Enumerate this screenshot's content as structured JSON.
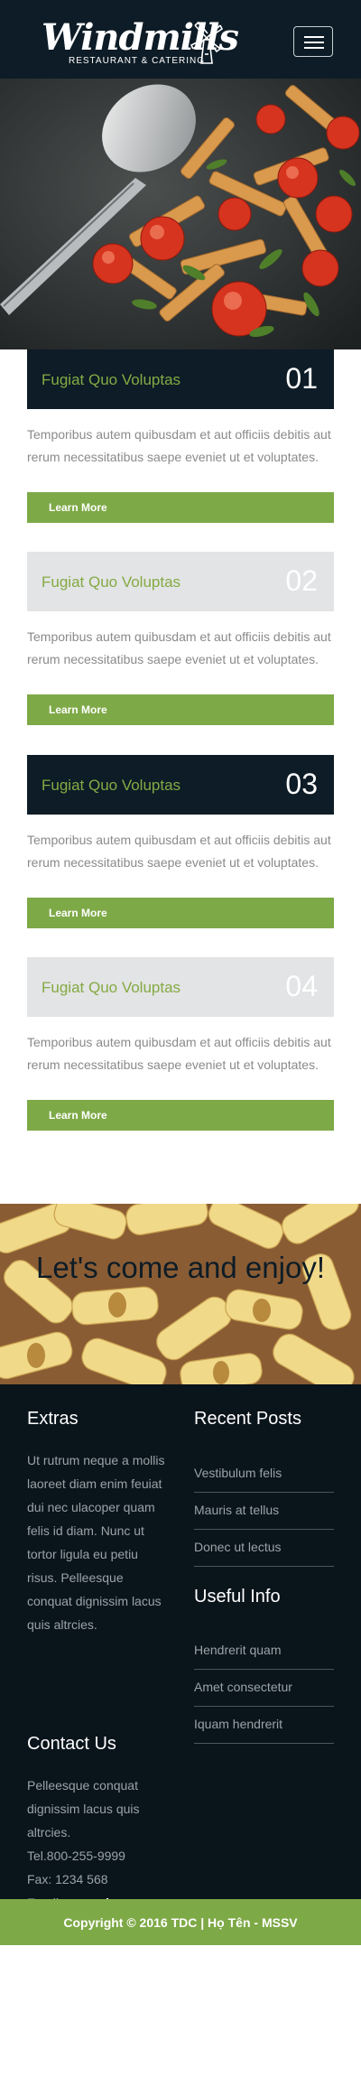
{
  "brand": {
    "name": "Windmills",
    "tagline": "RESTAURANT & CATERING"
  },
  "header": {
    "menu_icon": "hamburger-icon"
  },
  "features": [
    {
      "title": "Fugiat Quo Voluptas",
      "number": "01",
      "text": "Temporibus autem quibusdam et aut officiis debitis aut rerum necessitatibus saepe eveniet ut et voluptates.",
      "button": "Learn More"
    },
    {
      "title": "Fugiat Quo Voluptas",
      "number": "02",
      "text": "Temporibus autem quibusdam et aut officiis debitis aut rerum necessitatibus saepe eveniet ut et voluptates.",
      "button": "Learn More"
    },
    {
      "title": "Fugiat Quo Voluptas",
      "number": "03",
      "text": "Temporibus autem quibusdam et aut officiis debitis aut rerum necessitatibus saepe eveniet ut et voluptates.",
      "button": "Learn More"
    },
    {
      "title": "Fugiat Quo Voluptas",
      "number": "04",
      "text": "Temporibus autem quibusdam et aut officiis debitis aut rerum necessitatibus saepe eveniet ut et voluptates.",
      "button": "Learn More"
    }
  ],
  "banner": {
    "text": "Let's come and enjoy!"
  },
  "footer": {
    "extras": {
      "heading": "Extras",
      "lines": [
        "Ut rutrum neque a mollis",
        "laoreet diam enim feuiat",
        "dui nec ulacoper quam",
        "felis id diam. Nunc ut",
        "tortor ligula eu petiu",
        "risus. Pelleesque",
        "conquat dignissim lacus",
        "quis altrcies."
      ]
    },
    "recent_posts": {
      "heading": "Recent Posts",
      "items": [
        "Vestibulum felis",
        "Mauris at tellus",
        "Donec ut lectus"
      ]
    },
    "useful_info": {
      "heading": "Useful Info",
      "items": [
        "Hendrerit quam",
        "Amet consectetur",
        "Iquam hendrerit"
      ]
    },
    "contact": {
      "heading": "Contact Us",
      "lines": [
        "Pelleesque conquat",
        "dignissim lacus quis",
        "altrcies."
      ],
      "tel": "Tel.800-255-9999",
      "fax": "Fax: 1234 568",
      "email_label": "Email:",
      "email": "example.com"
    },
    "copyright": "Copyright © 2016 TDC | Họ Tên - MSSV"
  },
  "colors": {
    "navy": "#0d1c26",
    "green": "#7ea947",
    "title_green": "#84aa44",
    "light_gray": "#e3e4e5"
  }
}
